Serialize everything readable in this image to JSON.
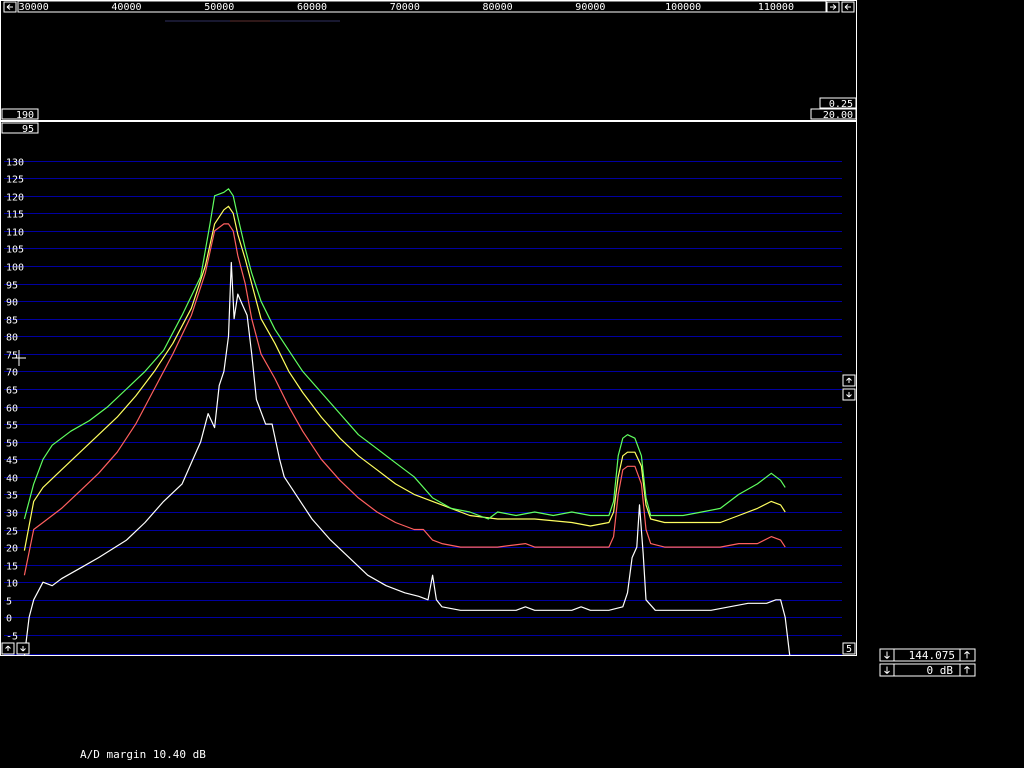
{
  "top_axis": {
    "freq_labels": [
      "30000",
      "40000",
      "50000",
      "60000",
      "70000",
      "80000",
      "90000",
      "100000",
      "110000"
    ],
    "freq_values": [
      30000,
      40000,
      50000,
      60000,
      70000,
      80000,
      90000,
      100000,
      110000
    ]
  },
  "top_panel": {
    "left_value": "190",
    "right_top_value": "0.25",
    "right_bottom_value": "20.00"
  },
  "main_panel": {
    "left_top_value": "95",
    "right_bottom_value": "5"
  },
  "controls": {
    "frequency": "144.075",
    "gain": "0 dB"
  },
  "status": {
    "ad_margin": "A/D margin 10.40 dB"
  },
  "colors": {
    "background": "#000000",
    "frame": "#ffffff",
    "grid": "#0000a0",
    "series_white": "#ffffff",
    "series_red": "#ff6060",
    "series_yellow": "#ffff60",
    "series_green": "#60ff60"
  },
  "icons": {
    "left_arrow": "arrow-left-icon",
    "right_arrow": "arrow-right-icon",
    "up_arrow": "arrow-up-icon",
    "down_arrow": "arrow-down-icon",
    "cursor": "crosshair-icon"
  },
  "chart_data": {
    "type": "line",
    "xlim": [
      26800,
      118200
    ],
    "ylim": [
      -11,
      141
    ],
    "yticks": [
      130,
      125,
      120,
      115,
      110,
      105,
      100,
      95,
      90,
      85,
      80,
      75,
      70,
      65,
      60,
      55,
      50,
      45,
      40,
      35,
      30,
      25,
      20,
      15,
      10,
      5,
      0,
      -5
    ],
    "ytick_labels": [
      "130",
      "125",
      "120",
      "115",
      "110",
      "105",
      "100",
      "95",
      "90",
      "85",
      "80",
      "75",
      "70",
      "65",
      "60",
      "55",
      "50",
      "45",
      "40",
      "35",
      "30",
      "25",
      "20",
      "15",
      "10",
      "5",
      "0",
      "-5"
    ],
    "grid": true,
    "series": [
      {
        "color": "white",
        "points": [
          [
            29000,
            -11
          ],
          [
            29500,
            0
          ],
          [
            30000,
            5
          ],
          [
            31000,
            10
          ],
          [
            32000,
            9
          ],
          [
            33000,
            11
          ],
          [
            35000,
            14
          ],
          [
            37000,
            17
          ],
          [
            40000,
            22
          ],
          [
            42000,
            27
          ],
          [
            44000,
            33
          ],
          [
            46000,
            38
          ],
          [
            47000,
            44
          ],
          [
            48000,
            50
          ],
          [
            48800,
            58
          ],
          [
            49500,
            54
          ],
          [
            50000,
            66
          ],
          [
            50500,
            70
          ],
          [
            51000,
            80
          ],
          [
            51300,
            101
          ],
          [
            51600,
            85
          ],
          [
            52000,
            92
          ],
          [
            52500,
            89
          ],
          [
            53000,
            86
          ],
          [
            53500,
            75
          ],
          [
            54000,
            62
          ],
          [
            55000,
            55
          ],
          [
            55700,
            55
          ],
          [
            56500,
            45
          ],
          [
            57000,
            40
          ],
          [
            58000,
            36
          ],
          [
            59000,
            32
          ],
          [
            60000,
            28
          ],
          [
            62000,
            22
          ],
          [
            64000,
            17
          ],
          [
            66000,
            12
          ],
          [
            68000,
            9
          ],
          [
            70000,
            7
          ],
          [
            71500,
            6
          ],
          [
            72500,
            5
          ],
          [
            73000,
            12
          ],
          [
            73400,
            5
          ],
          [
            74000,
            3
          ],
          [
            76000,
            2
          ],
          [
            78000,
            2
          ],
          [
            80000,
            2
          ],
          [
            82000,
            2
          ],
          [
            83000,
            3
          ],
          [
            84000,
            2
          ],
          [
            86000,
            2
          ],
          [
            88000,
            2
          ],
          [
            89000,
            3
          ],
          [
            90000,
            2
          ],
          [
            92000,
            2
          ],
          [
            93500,
            3
          ],
          [
            94000,
            7
          ],
          [
            94500,
            17
          ],
          [
            95000,
            20
          ],
          [
            95300,
            32
          ],
          [
            95700,
            18
          ],
          [
            96000,
            5
          ],
          [
            97000,
            2
          ],
          [
            99000,
            2
          ],
          [
            101000,
            2
          ],
          [
            103000,
            2
          ],
          [
            105000,
            3
          ],
          [
            107000,
            4
          ],
          [
            109000,
            4
          ],
          [
            110000,
            5
          ],
          [
            110500,
            5
          ],
          [
            111000,
            0
          ],
          [
            111500,
            -11
          ]
        ]
      },
      {
        "color": "red",
        "points": [
          [
            29000,
            12
          ],
          [
            30000,
            25
          ],
          [
            31000,
            27
          ],
          [
            33000,
            31
          ],
          [
            35000,
            36
          ],
          [
            37000,
            41
          ],
          [
            39000,
            47
          ],
          [
            41000,
            55
          ],
          [
            43000,
            65
          ],
          [
            45000,
            75
          ],
          [
            47000,
            86
          ],
          [
            48500,
            98
          ],
          [
            49500,
            110
          ],
          [
            50500,
            112
          ],
          [
            51000,
            112
          ],
          [
            51500,
            110
          ],
          [
            52000,
            103
          ],
          [
            52800,
            95
          ],
          [
            53500,
            85
          ],
          [
            54500,
            75
          ],
          [
            56000,
            68
          ],
          [
            57500,
            60
          ],
          [
            59000,
            53
          ],
          [
            61000,
            45
          ],
          [
            63000,
            39
          ],
          [
            65000,
            34
          ],
          [
            67000,
            30
          ],
          [
            69000,
            27
          ],
          [
            71000,
            25
          ],
          [
            72000,
            25
          ],
          [
            73000,
            22
          ],
          [
            74000,
            21
          ],
          [
            76000,
            20
          ],
          [
            80000,
            20
          ],
          [
            83000,
            21
          ],
          [
            84000,
            20
          ],
          [
            86000,
            20
          ],
          [
            88000,
            20
          ],
          [
            90000,
            20
          ],
          [
            92000,
            20
          ],
          [
            92500,
            23
          ],
          [
            93000,
            35
          ],
          [
            93500,
            42
          ],
          [
            94000,
            43
          ],
          [
            94800,
            43
          ],
          [
            95500,
            38
          ],
          [
            96000,
            25
          ],
          [
            96500,
            21
          ],
          [
            98000,
            20
          ],
          [
            101000,
            20
          ],
          [
            104000,
            20
          ],
          [
            106000,
            21
          ],
          [
            108000,
            21
          ],
          [
            109500,
            23
          ],
          [
            110500,
            22
          ],
          [
            111000,
            20
          ]
        ]
      },
      {
        "color": "yellow",
        "points": [
          [
            29000,
            19
          ],
          [
            30000,
            33
          ],
          [
            31000,
            37
          ],
          [
            33000,
            42
          ],
          [
            35000,
            47
          ],
          [
            37000,
            52
          ],
          [
            39000,
            57
          ],
          [
            41000,
            63
          ],
          [
            43000,
            70
          ],
          [
            45000,
            78
          ],
          [
            47000,
            88
          ],
          [
            48500,
            100
          ],
          [
            49500,
            112
          ],
          [
            50500,
            116
          ],
          [
            51000,
            117
          ],
          [
            51500,
            115
          ],
          [
            52000,
            109
          ],
          [
            52800,
            102
          ],
          [
            53500,
            95
          ],
          [
            54500,
            85
          ],
          [
            56000,
            78
          ],
          [
            57500,
            70
          ],
          [
            59000,
            64
          ],
          [
            61000,
            57
          ],
          [
            63000,
            51
          ],
          [
            65000,
            46
          ],
          [
            67000,
            42
          ],
          [
            69000,
            38
          ],
          [
            71000,
            35
          ],
          [
            73000,
            33
          ],
          [
            75000,
            31
          ],
          [
            77000,
            29
          ],
          [
            80000,
            28
          ],
          [
            84000,
            28
          ],
          [
            88000,
            27
          ],
          [
            90000,
            26
          ],
          [
            92000,
            27
          ],
          [
            92500,
            30
          ],
          [
            93000,
            40
          ],
          [
            93500,
            46
          ],
          [
            94000,
            47
          ],
          [
            94800,
            47
          ],
          [
            95500,
            43
          ],
          [
            96000,
            32
          ],
          [
            96500,
            28
          ],
          [
            98000,
            27
          ],
          [
            101000,
            27
          ],
          [
            104000,
            27
          ],
          [
            106000,
            29
          ],
          [
            108000,
            31
          ],
          [
            109500,
            33
          ],
          [
            110500,
            32
          ],
          [
            111000,
            30
          ]
        ]
      },
      {
        "color": "green",
        "points": [
          [
            29000,
            28
          ],
          [
            30000,
            38
          ],
          [
            31000,
            45
          ],
          [
            32000,
            49
          ],
          [
            34000,
            53
          ],
          [
            36000,
            56
          ],
          [
            38000,
            60
          ],
          [
            40000,
            65
          ],
          [
            42000,
            70
          ],
          [
            44000,
            76
          ],
          [
            46000,
            86
          ],
          [
            48000,
            97
          ],
          [
            49000,
            112
          ],
          [
            49500,
            120
          ],
          [
            50500,
            121
          ],
          [
            51000,
            122
          ],
          [
            51500,
            120
          ],
          [
            52000,
            114
          ],
          [
            52800,
            105
          ],
          [
            53500,
            98
          ],
          [
            54500,
            90
          ],
          [
            56000,
            82
          ],
          [
            57500,
            76
          ],
          [
            59000,
            70
          ],
          [
            61000,
            64
          ],
          [
            63000,
            58
          ],
          [
            65000,
            52
          ],
          [
            67000,
            48
          ],
          [
            69000,
            44
          ],
          [
            71000,
            40
          ],
          [
            73000,
            34
          ],
          [
            75000,
            31
          ],
          [
            77000,
            30
          ],
          [
            79000,
            28
          ],
          [
            80000,
            30
          ],
          [
            82000,
            29
          ],
          [
            84000,
            30
          ],
          [
            86000,
            29
          ],
          [
            88000,
            30
          ],
          [
            90000,
            29
          ],
          [
            92000,
            29
          ],
          [
            92500,
            33
          ],
          [
            93000,
            46
          ],
          [
            93500,
            51
          ],
          [
            94000,
            52
          ],
          [
            94800,
            51
          ],
          [
            95500,
            46
          ],
          [
            96000,
            34
          ],
          [
            96500,
            29
          ],
          [
            98000,
            29
          ],
          [
            100000,
            29
          ],
          [
            102000,
            30
          ],
          [
            104000,
            31
          ],
          [
            106000,
            35
          ],
          [
            108000,
            38
          ],
          [
            109500,
            41
          ],
          [
            110500,
            39
          ],
          [
            111000,
            37
          ]
        ]
      }
    ]
  }
}
